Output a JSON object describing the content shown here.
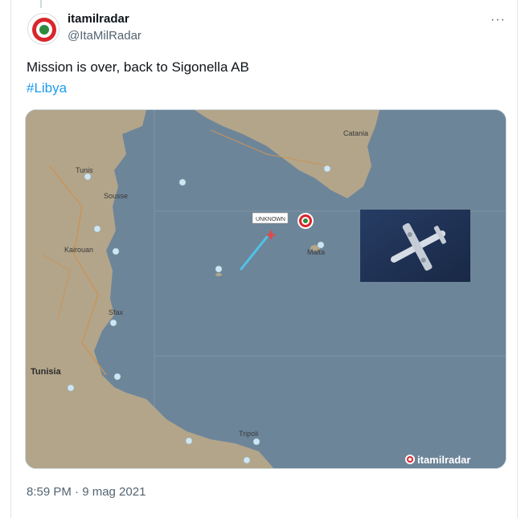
{
  "tweet": {
    "author": {
      "display_name": "itamilradar",
      "handle": "@ItaMilRadar",
      "avatar": "roundel-avatar"
    },
    "more_icon": "more-dots-icon",
    "more_label": "···",
    "text": "Mission is over, back to Sigonella AB",
    "hashtag": "#Libya",
    "timestamp": "8:59 PM · 9 mag 2021",
    "colors": {
      "link": "#1d9bf0",
      "secondary_text": "#536471",
      "sea": "#6d8599",
      "land": "#b3a58a",
      "roundel_red": "#d9262b",
      "roundel_green": "#2e8b3e"
    }
  },
  "media": {
    "alt_kind": "flight-tracking-map",
    "map_labels": {
      "sicily_city": "Catania",
      "island_label": "Malta",
      "country_label": "Tunisia",
      "flight_tag": "UNKNOWN",
      "city_sfax": "Sfax",
      "city_tripoli": "Tripoli",
      "city_tunis": "Tunis",
      "region_sousse": "Sousse",
      "region_kairouan": "Kairouan"
    },
    "watermark": "itamilradar"
  }
}
